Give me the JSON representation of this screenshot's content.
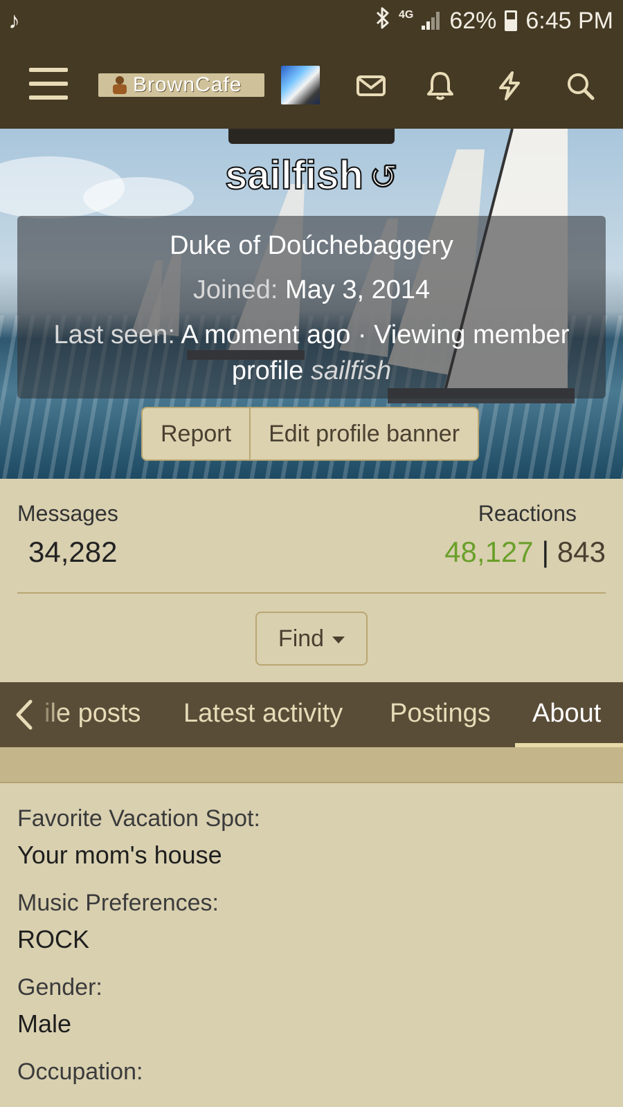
{
  "status_bar": {
    "network": "4G",
    "battery": "62%",
    "time": "6:45 PM"
  },
  "header": {
    "logo_text": "BrownCafe"
  },
  "profile": {
    "username": "sailfish",
    "title": "Duke of Doúchebaggery",
    "joined_label": "Joined:",
    "joined_value": "May 3, 2014",
    "last_seen_label": "Last seen:",
    "last_seen_value": "A moment ago · Viewing member profile",
    "last_seen_profile": "sailfish",
    "buttons": {
      "report": "Report",
      "edit_banner": "Edit profile banner"
    }
  },
  "stats": {
    "messages_label": "Messages",
    "messages_value": "34,282",
    "reactions_label": "Reactions",
    "reactions_positive": "48,127",
    "reactions_separator": "|",
    "reactions_other": "843"
  },
  "find_label": "Find",
  "tabs": [
    {
      "label": "ile posts"
    },
    {
      "label": "Latest activity"
    },
    {
      "label": "Postings"
    },
    {
      "label": "About"
    }
  ],
  "about": [
    {
      "label": "Favorite Vacation Spot:",
      "value": "Your mom's house"
    },
    {
      "label": "Music Preferences:",
      "value": "ROCK"
    },
    {
      "label": "Gender:",
      "value": "Male"
    },
    {
      "label": "Occupation:",
      "value": ""
    }
  ],
  "colors": {
    "header_bg": "#453a24",
    "page_bg": "#d9d0b0",
    "tab_bg": "#5a4d38",
    "accent_green": "#6aa02a"
  }
}
